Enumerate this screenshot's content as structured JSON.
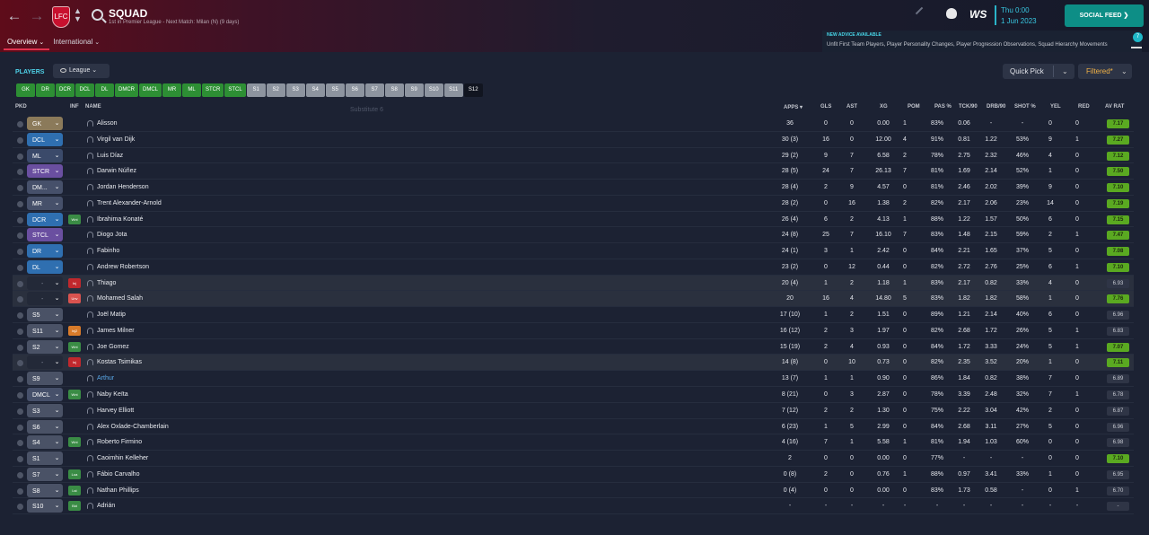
{
  "header": {
    "title": "SQUAD",
    "subtitle": "1st in Premier League - Next Match: Milan (N) (9 days)",
    "crest": "LFC",
    "tabs": [
      "Overview",
      "International"
    ],
    "brand": "WS",
    "day_time": "Thu 0:00",
    "date": "1 Jun 2023",
    "social_feed": "SOCIAL FEED",
    "advice_title": "NEW ADVICE AVAILABLE",
    "advice_text": "Unfit First Team Players, Player Personality Changes, Player Progression Observations, Squad Hierarchy Movements",
    "advice_count": "7"
  },
  "toolbar": {
    "players_label": "PLAYERS",
    "league": "League",
    "quick_pick": "Quick Pick",
    "filtered": "Filtered*",
    "hover_hint": "Substitute 6"
  },
  "positions": [
    {
      "label": "GK",
      "kind": "g"
    },
    {
      "label": "DR",
      "kind": "g"
    },
    {
      "label": "DCR",
      "kind": "g"
    },
    {
      "label": "DCL",
      "kind": "g"
    },
    {
      "label": "DL",
      "kind": "g"
    },
    {
      "label": "DMCR",
      "kind": "g"
    },
    {
      "label": "DMCL",
      "kind": "g"
    },
    {
      "label": "MR",
      "kind": "g"
    },
    {
      "label": "ML",
      "kind": "g"
    },
    {
      "label": "STCR",
      "kind": "g"
    },
    {
      "label": "STCL",
      "kind": "g"
    },
    {
      "label": "S1",
      "kind": "s"
    },
    {
      "label": "S2",
      "kind": "s"
    },
    {
      "label": "S3",
      "kind": "s"
    },
    {
      "label": "S4",
      "kind": "s"
    },
    {
      "label": "S5",
      "kind": "s"
    },
    {
      "label": "S6",
      "kind": "s"
    },
    {
      "label": "S7",
      "kind": "s"
    },
    {
      "label": "S8",
      "kind": "s"
    },
    {
      "label": "S9",
      "kind": "s"
    },
    {
      "label": "S10",
      "kind": "s"
    },
    {
      "label": "S11",
      "kind": "s"
    },
    {
      "label": "S12",
      "kind": "cur"
    }
  ],
  "columns": {
    "pkd": "PKD",
    "inf": "INF",
    "name": "NAME",
    "apps": "APPS",
    "gls": "GLS",
    "ast": "AST",
    "xg": "XG",
    "pom": "POM",
    "pas": "PAS %",
    "tck": "TCK/90",
    "drb": "DRB/90",
    "shot": "SHOT %",
    "yel": "YEL",
    "red": "RED",
    "avrat": "AV RAT"
  },
  "colors": {
    "GK": "#8b7a5a",
    "DCL": "#2f6fb0",
    "ML": "#3b4a6a",
    "STCR": "#6a4fa0",
    "DM": "#46506a",
    "MR": "#46506a",
    "DCR": "#2f6fb0",
    "STCL": "#6a4fa0",
    "DR": "#2f6fb0",
    "DL": "#2f6fb0",
    "S": "#4a5266",
    "Inj": "#c0282d",
    "Unv": "#d9534f",
    "Wnt": "#3a8c45",
    "Loa": "#3a8c45",
    "Lst": "#3a8c45",
    "Bid": "#3a8c45",
    "Inj2": "#d87b2a"
  },
  "players": [
    {
      "pos": "GK",
      "posc": "GK",
      "inf": "",
      "name": "Alisson",
      "apps": "36",
      "gls": "0",
      "ast": "0",
      "xg": "0.00",
      "pom": "1",
      "pas": "83%",
      "tck": "0.06",
      "drb": "-",
      "shot": "-",
      "yel": "0",
      "red": "0",
      "av": "7.17",
      "hi": true
    },
    {
      "pos": "DCL",
      "posc": "DCL",
      "inf": "",
      "name": "Virgil van Dijk",
      "apps": "30 (3)",
      "gls": "16",
      "ast": "0",
      "xg": "12.00",
      "pom": "4",
      "pas": "91%",
      "tck": "0.81",
      "drb": "1.22",
      "shot": "53%",
      "yel": "9",
      "red": "1",
      "av": "7.27",
      "hi": true
    },
    {
      "pos": "ML",
      "posc": "ML",
      "inf": "",
      "name": "Luis Díaz",
      "apps": "29 (2)",
      "gls": "9",
      "ast": "7",
      "xg": "6.58",
      "pom": "2",
      "pas": "78%",
      "tck": "2.75",
      "drb": "2.32",
      "shot": "46%",
      "yel": "4",
      "red": "0",
      "av": "7.12",
      "hi": true
    },
    {
      "pos": "STCR",
      "posc": "STCR",
      "inf": "",
      "name": "Darwin Núñez",
      "apps": "28 (5)",
      "gls": "24",
      "ast": "7",
      "xg": "26.13",
      "pom": "7",
      "pas": "81%",
      "tck": "1.69",
      "drb": "2.14",
      "shot": "52%",
      "yel": "1",
      "red": "0",
      "av": "7.50",
      "hi": true
    },
    {
      "pos": "DM...",
      "posc": "DM",
      "inf": "",
      "name": "Jordan Henderson",
      "apps": "28 (4)",
      "gls": "2",
      "ast": "9",
      "xg": "4.57",
      "pom": "0",
      "pas": "81%",
      "tck": "2.46",
      "drb": "2.02",
      "shot": "39%",
      "yel": "9",
      "red": "0",
      "av": "7.10",
      "hi": true
    },
    {
      "pos": "MR",
      "posc": "MR",
      "inf": "",
      "name": "Trent Alexander-Arnold",
      "apps": "28 (2)",
      "gls": "0",
      "ast": "16",
      "xg": "1.38",
      "pom": "2",
      "pas": "82%",
      "tck": "2.17",
      "drb": "2.06",
      "shot": "23%",
      "yel": "14",
      "red": "0",
      "av": "7.19",
      "hi": true
    },
    {
      "pos": "DCR",
      "posc": "DCR",
      "inf": "Wnt",
      "name": "Ibrahima Konaté",
      "apps": "26 (4)",
      "gls": "6",
      "ast": "2",
      "xg": "4.13",
      "pom": "1",
      "pas": "88%",
      "tck": "1.22",
      "drb": "1.57",
      "shot": "50%",
      "yel": "6",
      "red": "0",
      "av": "7.15",
      "hi": true
    },
    {
      "pos": "STCL",
      "posc": "STCL",
      "inf": "",
      "name": "Diogo Jota",
      "apps": "24 (8)",
      "gls": "25",
      "ast": "7",
      "xg": "16.10",
      "pom": "7",
      "pas": "83%",
      "tck": "1.48",
      "drb": "2.15",
      "shot": "59%",
      "yel": "2",
      "red": "1",
      "av": "7.47",
      "hi": true
    },
    {
      "pos": "DR",
      "posc": "DR",
      "inf": "",
      "name": "Fabinho",
      "apps": "24 (1)",
      "gls": "3",
      "ast": "1",
      "xg": "2.42",
      "pom": "0",
      "pas": "84%",
      "tck": "2.21",
      "drb": "1.65",
      "shot": "37%",
      "yel": "5",
      "red": "0",
      "av": "7.08",
      "hi": true
    },
    {
      "pos": "DL",
      "posc": "DL",
      "inf": "",
      "name": "Andrew Robertson",
      "apps": "23 (2)",
      "gls": "0",
      "ast": "12",
      "xg": "0.44",
      "pom": "0",
      "pas": "82%",
      "tck": "2.72",
      "drb": "2.76",
      "shot": "25%",
      "yel": "6",
      "red": "1",
      "av": "7.10",
      "hi": true
    },
    {
      "pos": "-",
      "posc": "none",
      "inf": "Inj",
      "name": "Thiago",
      "apps": "20 (4)",
      "gls": "1",
      "ast": "2",
      "xg": "1.18",
      "pom": "1",
      "pas": "83%",
      "tck": "2.17",
      "drb": "0.82",
      "shot": "33%",
      "yel": "4",
      "red": "0",
      "av": "6.93",
      "hi": false,
      "rowhl": true
    },
    {
      "pos": "-",
      "posc": "none",
      "inf": "Unv",
      "name": "Mohamed Salah",
      "apps": "20",
      "gls": "16",
      "ast": "4",
      "xg": "14.80",
      "pom": "5",
      "pas": "83%",
      "tck": "1.82",
      "drb": "1.82",
      "shot": "58%",
      "yel": "1",
      "red": "0",
      "av": "7.76",
      "hi": true,
      "rowhl": true
    },
    {
      "pos": "S5",
      "posc": "S",
      "inf": "",
      "name": "Joël Matip",
      "apps": "17 (10)",
      "gls": "1",
      "ast": "2",
      "xg": "1.51",
      "pom": "0",
      "pas": "89%",
      "tck": "1.21",
      "drb": "2.14",
      "shot": "40%",
      "yel": "6",
      "red": "0",
      "av": "6.96",
      "hi": false
    },
    {
      "pos": "S11",
      "posc": "S",
      "inf": "Inj2",
      "name": "James Milner",
      "apps": "16 (12)",
      "gls": "2",
      "ast": "3",
      "xg": "1.97",
      "pom": "0",
      "pas": "82%",
      "tck": "2.68",
      "drb": "1.72",
      "shot": "26%",
      "yel": "5",
      "red": "1",
      "av": "6.83",
      "hi": false
    },
    {
      "pos": "S2",
      "posc": "S",
      "inf": "Wnt",
      "name": "Joe Gomez",
      "apps": "15 (19)",
      "gls": "2",
      "ast": "4",
      "xg": "0.93",
      "pom": "0",
      "pas": "84%",
      "tck": "1.72",
      "drb": "3.33",
      "shot": "24%",
      "yel": "5",
      "red": "1",
      "av": "7.07",
      "hi": true
    },
    {
      "pos": "-",
      "posc": "none",
      "inf": "Inj",
      "name": "Kostas Tsimikas",
      "apps": "14 (8)",
      "gls": "0",
      "ast": "10",
      "xg": "0.73",
      "pom": "0",
      "pas": "82%",
      "tck": "2.35",
      "drb": "3.52",
      "shot": "20%",
      "yel": "1",
      "red": "0",
      "av": "7.11",
      "hi": true,
      "rowhl": true
    },
    {
      "pos": "S9",
      "posc": "S",
      "inf": "",
      "name": "Arthur",
      "apps": "13 (7)",
      "gls": "1",
      "ast": "1",
      "xg": "0.90",
      "pom": "0",
      "pas": "86%",
      "tck": "1.84",
      "drb": "0.82",
      "shot": "38%",
      "yel": "7",
      "red": "0",
      "av": "6.89",
      "hi": false,
      "link": true
    },
    {
      "pos": "DMCL",
      "posc": "DM",
      "inf": "Wnt",
      "name": "Naby Keïta",
      "apps": "8 (21)",
      "gls": "0",
      "ast": "3",
      "xg": "2.87",
      "pom": "0",
      "pas": "78%",
      "tck": "3.39",
      "drb": "2.48",
      "shot": "32%",
      "yel": "7",
      "red": "1",
      "av": "6.78",
      "hi": false
    },
    {
      "pos": "S3",
      "posc": "S",
      "inf": "",
      "name": "Harvey Elliott",
      "apps": "7 (12)",
      "gls": "2",
      "ast": "2",
      "xg": "1.30",
      "pom": "0",
      "pas": "75%",
      "tck": "2.22",
      "drb": "3.04",
      "shot": "42%",
      "yel": "2",
      "red": "0",
      "av": "6.87",
      "hi": false
    },
    {
      "pos": "S6",
      "posc": "S",
      "inf": "",
      "name": "Alex Oxlade-Chamberlain",
      "apps": "6 (23)",
      "gls": "1",
      "ast": "5",
      "xg": "2.99",
      "pom": "0",
      "pas": "84%",
      "tck": "2.68",
      "drb": "3.11",
      "shot": "27%",
      "yel": "5",
      "red": "0",
      "av": "6.96",
      "hi": false
    },
    {
      "pos": "S4",
      "posc": "S",
      "inf": "Wnt",
      "name": "Roberto Firmino",
      "apps": "4 (16)",
      "gls": "7",
      "ast": "1",
      "xg": "5.58",
      "pom": "1",
      "pas": "81%",
      "tck": "1.94",
      "drb": "1.03",
      "shot": "60%",
      "yel": "0",
      "red": "0",
      "av": "6.98",
      "hi": false
    },
    {
      "pos": "S1",
      "posc": "S",
      "inf": "",
      "name": "Caoimhin Kelleher",
      "apps": "2",
      "gls": "0",
      "ast": "0",
      "xg": "0.00",
      "pom": "0",
      "pas": "77%",
      "tck": "-",
      "drb": "-",
      "shot": "-",
      "yel": "0",
      "red": "0",
      "av": "7.10",
      "hi": true
    },
    {
      "pos": "S7",
      "posc": "S",
      "inf": "Loa",
      "name": "Fábio Carvalho",
      "apps": "0 (8)",
      "gls": "2",
      "ast": "0",
      "xg": "0.76",
      "pom": "1",
      "pas": "88%",
      "tck": "0.97",
      "drb": "3.41",
      "shot": "33%",
      "yel": "1",
      "red": "0",
      "av": "6.95",
      "hi": false
    },
    {
      "pos": "S8",
      "posc": "S",
      "inf": "Lst",
      "name": "Nathan Phillips",
      "apps": "0 (4)",
      "gls": "0",
      "ast": "0",
      "xg": "0.00",
      "pom": "0",
      "pas": "83%",
      "tck": "1.73",
      "drb": "0.58",
      "shot": "-",
      "yel": "0",
      "red": "1",
      "av": "6.70",
      "hi": false
    },
    {
      "pos": "S10",
      "posc": "S",
      "inf": "Bid",
      "name": "Adrián",
      "apps": "-",
      "gls": "-",
      "ast": "-",
      "xg": "-",
      "pom": "-",
      "pas": "-",
      "tck": "-",
      "drb": "-",
      "shot": "-",
      "yel": "-",
      "red": "-",
      "av": "-",
      "hi": false
    }
  ]
}
